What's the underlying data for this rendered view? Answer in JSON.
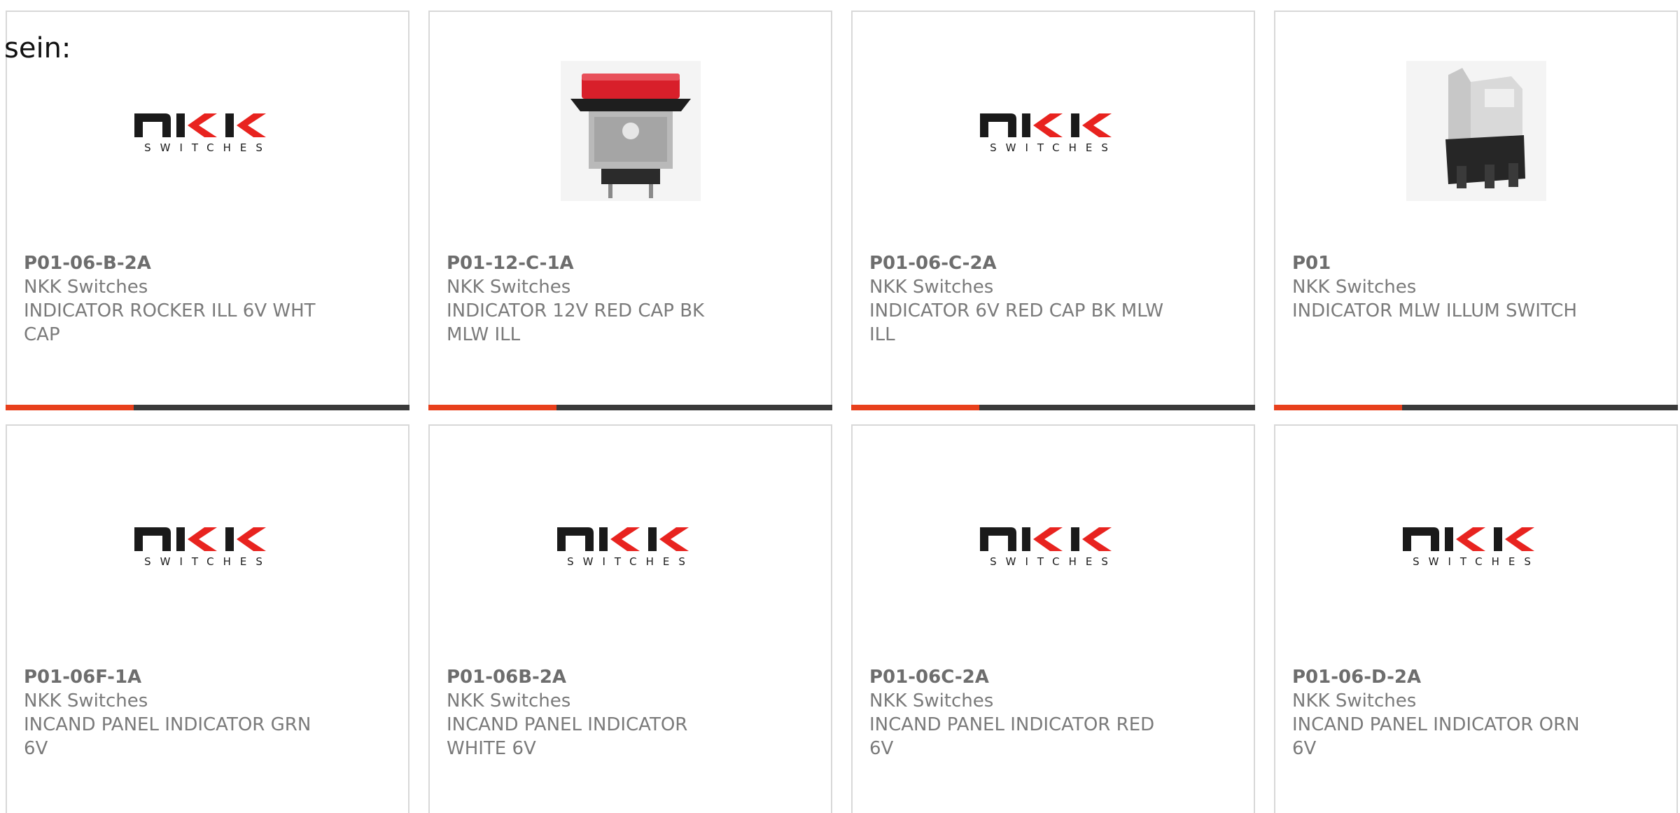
{
  "lead_text": "sein:",
  "brand": {
    "logo_main": "NKK",
    "logo_sub": "SWITCHES",
    "accent_color": "#e8401c",
    "bar_color": "#3a3a3a"
  },
  "products": [
    {
      "part_number": "P01-06-B-2A",
      "manufacturer": "NKK Switches",
      "description_line1": "INDICATOR ROCKER ILL 6V WHT",
      "description_line2": "CAP",
      "image": "nkk-logo"
    },
    {
      "part_number": "P01-12-C-1A",
      "manufacturer": "NKK Switches",
      "description_line1": "INDICATOR 12V RED CAP BK",
      "description_line2": "MLW ILL",
      "image": "red-cap-switch-photo"
    },
    {
      "part_number": "P01-06-C-2A",
      "manufacturer": "NKK Switches",
      "description_line1": "INDICATOR 6V RED CAP BK MLW",
      "description_line2": "ILL",
      "image": "nkk-logo"
    },
    {
      "part_number": "P01",
      "manufacturer": "NKK Switches",
      "description_line1": "INDICATOR MLW ILLUM SWITCH",
      "description_line2": "",
      "image": "metal-switch-photo"
    },
    {
      "part_number": "P01-06F-1A",
      "manufacturer": "NKK Switches",
      "description_line1": "INCAND PANEL INDICATOR GRN",
      "description_line2": "6V",
      "image": "nkk-logo"
    },
    {
      "part_number": "P01-06B-2A",
      "manufacturer": "NKK Switches",
      "description_line1": "INCAND PANEL INDICATOR",
      "description_line2": "WHITE 6V",
      "image": "nkk-logo"
    },
    {
      "part_number": "P01-06C-2A",
      "manufacturer": "NKK Switches",
      "description_line1": "INCAND PANEL INDICATOR RED",
      "description_line2": "6V",
      "image": "nkk-logo"
    },
    {
      "part_number": "P01-06-D-2A",
      "manufacturer": "NKK Switches",
      "description_line1": "INCAND PANEL INDICATOR ORN",
      "description_line2": "6V",
      "image": "nkk-logo"
    }
  ]
}
